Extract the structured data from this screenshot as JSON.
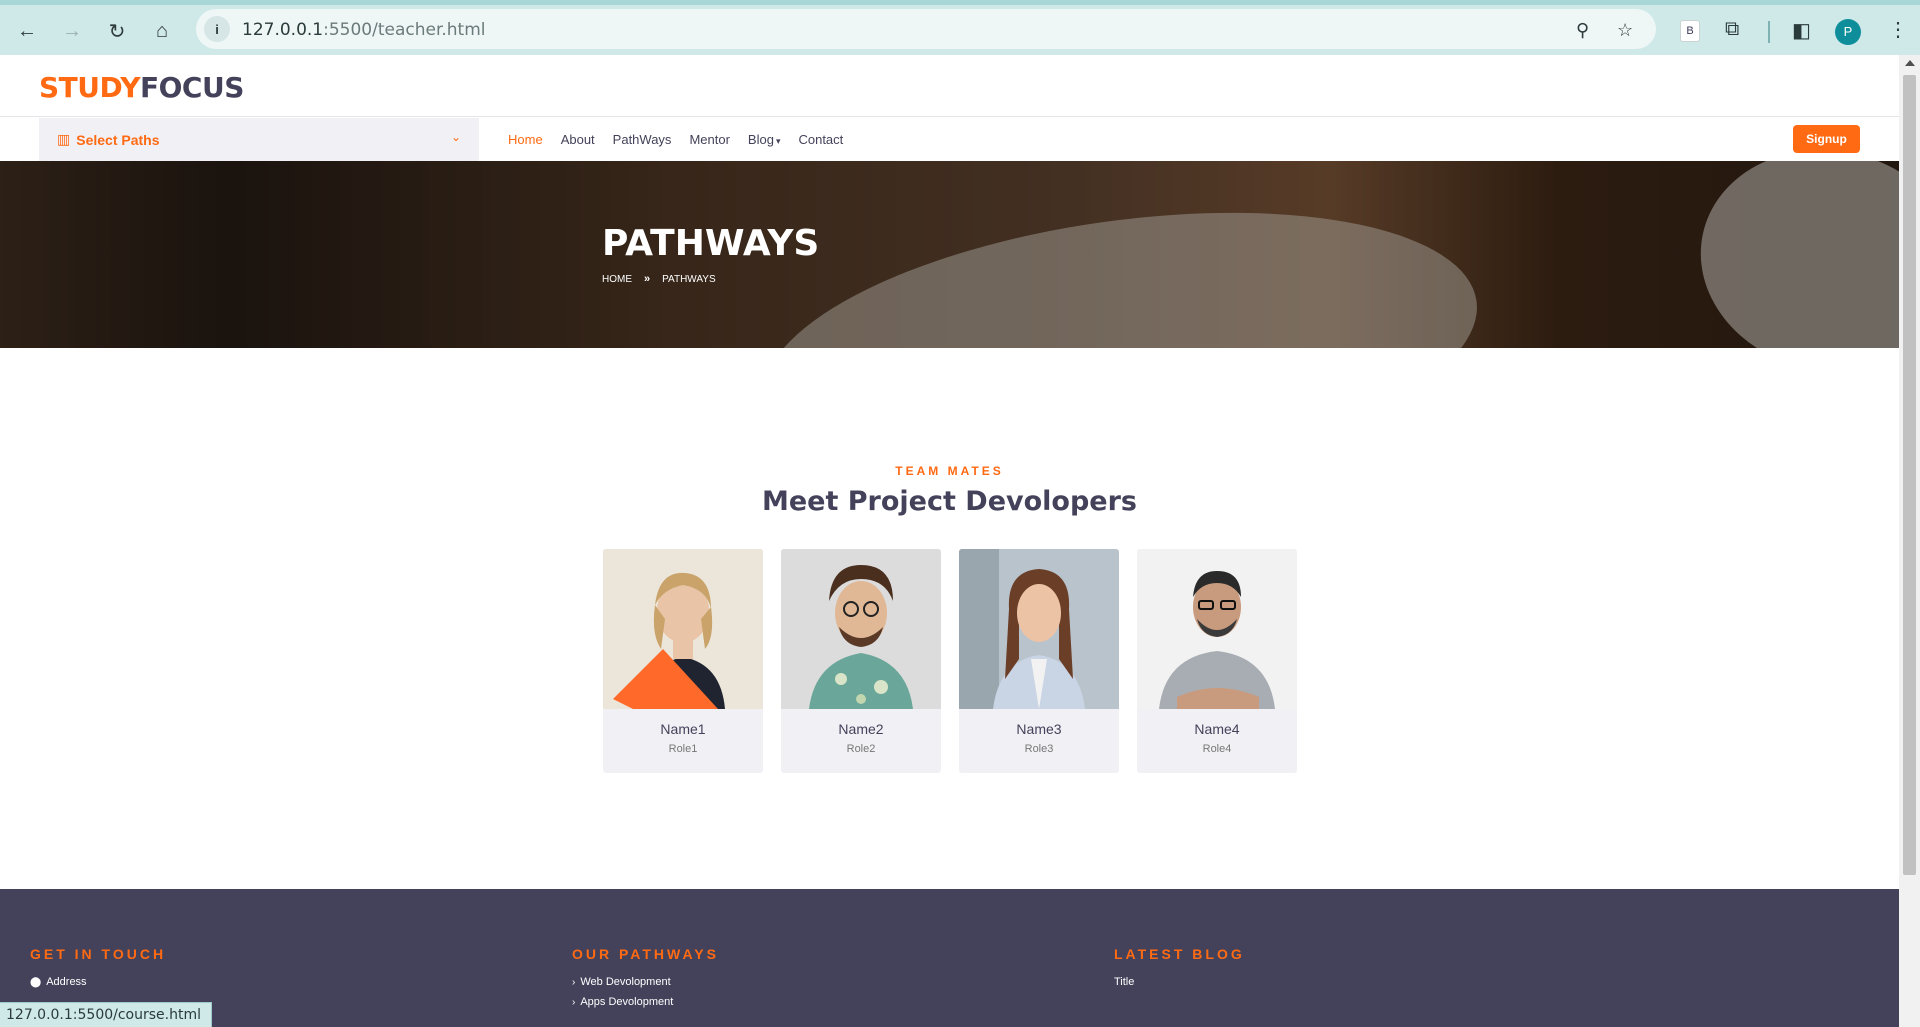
{
  "browser": {
    "url_host": "127.0.0.1",
    "url_rest": ":5500/teacher.html",
    "profile_initial": "P",
    "extension_label": "B",
    "status_url": "127.0.0.1:5500/course.html"
  },
  "brand": {
    "part1": "STUDY",
    "part2": "FOCUS"
  },
  "paths_select": {
    "label": "Select Paths"
  },
  "nav": {
    "home": "Home",
    "about": "About",
    "pathways": "PathWays",
    "mentor": "Mentor",
    "blog": "Blog",
    "contact": "Contact",
    "signup": "Signup"
  },
  "hero": {
    "title": "PATHWAYS",
    "crumb_home": "HOME",
    "crumb_current": "PATHWAYS"
  },
  "team": {
    "subtitle": "TEAM MATES",
    "title": "Meet Project Devolopers",
    "members": [
      {
        "name": "Name1",
        "role": "Role1"
      },
      {
        "name": "Name2",
        "role": "Role2"
      },
      {
        "name": "Name3",
        "role": "Role3"
      },
      {
        "name": "Name4",
        "role": "Role4"
      }
    ]
  },
  "footer": {
    "contact_heading": "GET IN TOUCH",
    "contact_address": "Address",
    "pathways_heading": "OUR PATHWAYS",
    "pathways_items": [
      "Web Devolopment",
      "Apps Devolopment"
    ],
    "blog_heading": "LATEST BLOG",
    "blog_item": "Title"
  },
  "colors": {
    "accent": "#ff6a13",
    "dark": "#44425a",
    "chrome": "#cfe9e9"
  }
}
